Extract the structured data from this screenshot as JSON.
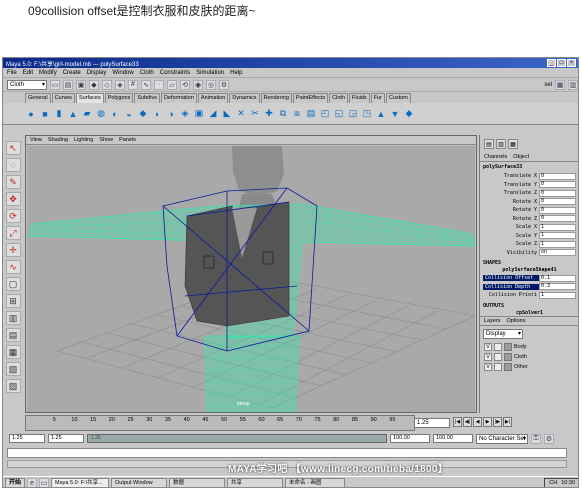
{
  "caption": "09collision offset是控制衣服和皮肤的距离~",
  "window": {
    "title": "Maya 5.0: F:\\共享\\girl-model.mb  ---  polySurface33"
  },
  "menubar": [
    "File",
    "Edit",
    "Modify",
    "Create",
    "Display",
    "Window",
    "Cloth",
    "Constraints",
    "Simulation",
    "Help"
  ],
  "statusline": {
    "mode": "Cloth",
    "sel_label": "sel"
  },
  "shelf_tabs": [
    "General",
    "Curves",
    "Surfaces",
    "Polygons",
    "Subdivs",
    "Deformation",
    "Animation",
    "Dynamics",
    "Rendering",
    "PaintEffects",
    "Cloth",
    "Fluids",
    "Fur",
    "Custom"
  ],
  "shelf_active": "Surfaces",
  "panel_menu": [
    "View",
    "Shading",
    "Lighting",
    "Show",
    "Panels"
  ],
  "channel_box": {
    "tabs": [
      "Channels",
      "Object"
    ],
    "object": "polySurface33",
    "channels": [
      {
        "label": "Translate X",
        "value": "0"
      },
      {
        "label": "Translate Y",
        "value": "0"
      },
      {
        "label": "Translate Z",
        "value": "0"
      },
      {
        "label": "Rotate X",
        "value": "0"
      },
      {
        "label": "Rotate Y",
        "value": "0"
      },
      {
        "label": "Rotate Z",
        "value": "0"
      },
      {
        "label": "Scale X",
        "value": "1"
      },
      {
        "label": "Scale Y",
        "value": "1"
      },
      {
        "label": "Scale Z",
        "value": "1"
      },
      {
        "label": "Visibility",
        "value": "on"
      }
    ],
    "shapes_header": "SHAPES",
    "shape_name": "polySurfaceShape41",
    "shape_channels": [
      {
        "label": "Collision Offset",
        "value": "0.1",
        "highlight": true
      },
      {
        "label": "Collision Depth",
        "value": "0.3",
        "highlight": true
      },
      {
        "label": "Collision Priori",
        "value": "1",
        "highlight": false
      }
    ],
    "outputs_header": "OUTPUTS",
    "output_name": "cpSolver1"
  },
  "layers": {
    "tabs": [
      "Layers",
      "Options"
    ],
    "display": "Display",
    "items": [
      {
        "v": "V",
        "name": "Body"
      },
      {
        "v": "V",
        "name": "Cloth"
      },
      {
        "v": "V",
        "name": "Other"
      }
    ]
  },
  "timeline": {
    "ticks": [
      "5",
      "10",
      "15",
      "20",
      "25",
      "30",
      "35",
      "40",
      "45",
      "50",
      "55",
      "60",
      "65",
      "70",
      "75",
      "80",
      "85",
      "90",
      "95"
    ],
    "current_frame": "1.25"
  },
  "range": {
    "start": "1.25",
    "start2": "1.25",
    "slider_label": "1.25",
    "end": "100.00",
    "end2": "100.00",
    "character_set": "No Character Set"
  },
  "watermark": "MAYA学习吧 【www.linecg.com/tieba/1800】",
  "taskbar": {
    "start": "开始",
    "tasks": [
      "Maya 5.0: F:\\共享...",
      "Output Window",
      "数据",
      "共享",
      "未命名 - 画图"
    ],
    "tray_lang": "CH",
    "clock": "10:30"
  },
  "colors": {
    "title_start": "#0a2a8a",
    "mesh": "#34e8a8",
    "highlight": "#001a66"
  }
}
